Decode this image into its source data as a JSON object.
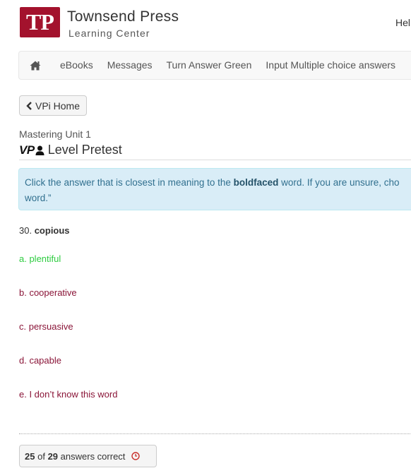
{
  "header": {
    "logo_text": "TP",
    "brand_name": "Townsend Press",
    "brand_sub": "Learning Center",
    "greeting": "Hel",
    "logo_color": "#a3122d"
  },
  "navbar": {
    "home_icon": "home-icon",
    "items": [
      {
        "label": "eBooks"
      },
      {
        "label": "Messages"
      },
      {
        "label": "Turn Answer Green"
      },
      {
        "label": "Input Multiple choice answers"
      }
    ]
  },
  "back_button": {
    "label": "VPi Home",
    "icon": "chevron-left-icon"
  },
  "section": {
    "unit_title": "Mastering Unit 1",
    "vp_mark": "VP",
    "level_title": "Level Pretest",
    "level_icon": "user-icon"
  },
  "instructions": {
    "before": "Click the answer that is closest in meaning to the ",
    "bold": "boldfaced",
    "after": " word. If you are unsure, cho",
    "line2": "word.”"
  },
  "question": {
    "number": "30.",
    "word": "copious",
    "answers": [
      {
        "label": "a. plentiful",
        "state": "correct"
      },
      {
        "label": "b. cooperative",
        "state": "default"
      },
      {
        "label": "c. persuasive",
        "state": "default"
      },
      {
        "label": "d. capable",
        "state": "default"
      },
      {
        "label": "e. I don’t know this word",
        "state": "default"
      }
    ]
  },
  "score": {
    "correct": "25",
    "of_text": "of",
    "total": "29",
    "suffix": "answers correct",
    "icon": "clock-icon"
  },
  "colors": {
    "answer_default": "#8a1538",
    "answer_correct": "#2ecc40",
    "alert_bg": "#d9edf7",
    "alert_text": "#31708f"
  }
}
